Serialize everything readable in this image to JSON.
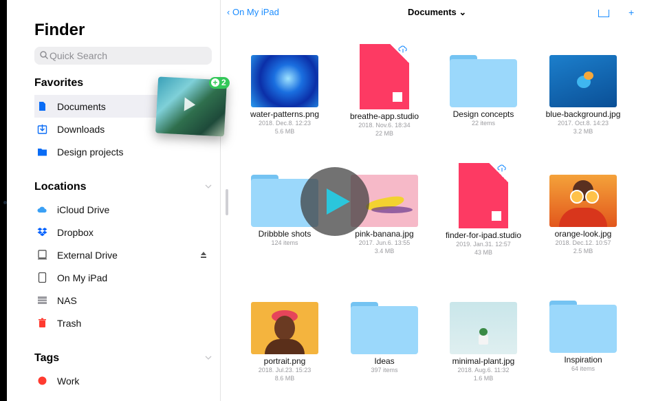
{
  "sidebar": {
    "title": "Finder",
    "search_placeholder": "Quick Search",
    "favorites": {
      "heading": "Favorites",
      "items": [
        {
          "label": "Documents",
          "icon": "document-icon"
        },
        {
          "label": "Downloads",
          "icon": "download-icon"
        },
        {
          "label": "Design projects",
          "icon": "folder-icon"
        }
      ]
    },
    "locations": {
      "heading": "Locations",
      "items": [
        {
          "label": "iCloud Drive",
          "icon": "cloud-icon"
        },
        {
          "label": "Dropbox",
          "icon": "dropbox-icon"
        },
        {
          "label": "External Drive",
          "icon": "drive-icon"
        },
        {
          "label": "On My iPad",
          "icon": "ipad-icon"
        },
        {
          "label": "NAS",
          "icon": "nas-icon"
        },
        {
          "label": "Trash",
          "icon": "trash-icon"
        }
      ]
    },
    "tags": {
      "heading": "Tags",
      "items": [
        {
          "label": "Work",
          "color": "#ff3b30"
        }
      ]
    },
    "drag_badge_count": "2"
  },
  "topbar": {
    "back_label": "On My iPad",
    "title": "Documents ⌄",
    "plus": "+"
  },
  "files": [
    {
      "name": "water-patterns.png",
      "date": "2018. Dec.8. 12:23",
      "size": "5.6 MB",
      "kind": "image"
    },
    {
      "name": "breathe-app.studio",
      "date": "2018. Nov.6. 18:34",
      "size": "22 MB",
      "kind": "studio"
    },
    {
      "name": "Design concepts",
      "date": "22 items",
      "size": "",
      "kind": "folder"
    },
    {
      "name": "blue-background.jpg",
      "date": "2017. Oct.8. 14:23",
      "size": "3.2 MB",
      "kind": "image"
    },
    {
      "name": "Dribbble shots",
      "date": "124 items",
      "size": "",
      "kind": "folder"
    },
    {
      "name": "pink-banana.jpg",
      "date": "2017. Jun.6. 13:55",
      "size": "3.4 MB",
      "kind": "image"
    },
    {
      "name": "finder-for-ipad.studio",
      "date": "2019. Jan.31. 12:57",
      "size": "43 MB",
      "kind": "studio"
    },
    {
      "name": "orange-look.jpg",
      "date": "2018. Dec.12. 10:57",
      "size": "2.5 MB",
      "kind": "image"
    },
    {
      "name": "portrait.png",
      "date": "2018. Jul.23. 15:23",
      "size": "8.6 MB",
      "kind": "image"
    },
    {
      "name": "Ideas",
      "date": "397 items",
      "size": "",
      "kind": "folder"
    },
    {
      "name": "minimal-plant.jpg",
      "date": "2018. Aug.6. 11:32",
      "size": "1.6 MB",
      "kind": "image"
    },
    {
      "name": "Inspiration",
      "date": "64 items",
      "size": "",
      "kind": "folder"
    }
  ],
  "colors": {
    "accent": "#1a8cff",
    "folder": "#9bd8fb",
    "studio": "#fd3a63"
  }
}
